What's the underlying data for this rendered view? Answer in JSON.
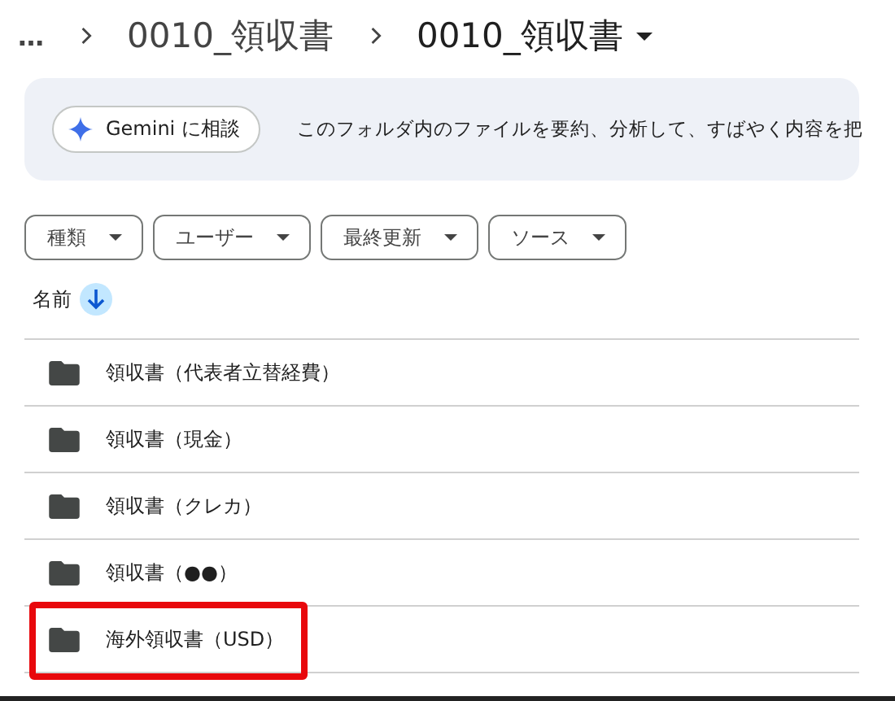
{
  "breadcrumb": {
    "overflow": "…",
    "items": [
      {
        "label": "0010_領収書",
        "current": false
      },
      {
        "label": "0010_領収書",
        "current": true
      }
    ]
  },
  "gemini_banner": {
    "button": "Gemini に相談",
    "text": "このフォルダ内のファイルを要約、分析して、すばやく内容を把"
  },
  "filters": [
    "種類",
    "ユーザー",
    "最終更新",
    "ソース"
  ],
  "list_header": {
    "label": "名前"
  },
  "rows": [
    {
      "name": "領収書（代表者立替経費）",
      "highlighted": false
    },
    {
      "name": "領収書（現金）",
      "highlighted": false
    },
    {
      "name": "領収書（クレカ）",
      "highlighted": false
    },
    {
      "name": "領収書（●●）",
      "highlighted": false
    },
    {
      "name": "海外領収書（USD）",
      "highlighted": true
    }
  ]
}
